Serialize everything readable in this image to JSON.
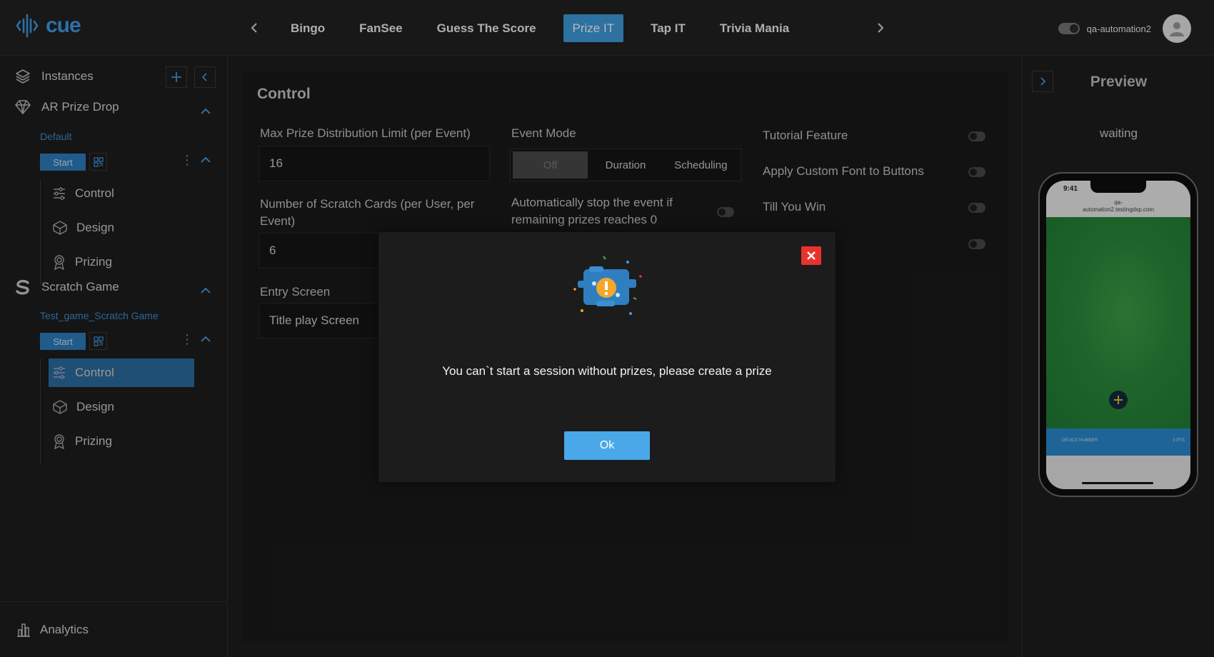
{
  "brand": {
    "name": "cue",
    "accent": "#3f9be8"
  },
  "nav": {
    "tabs": [
      {
        "label": "Bingo",
        "active": false
      },
      {
        "label": "FanSee",
        "active": false
      },
      {
        "label": "Guess The Score",
        "active": false
      },
      {
        "label": "Prize IT",
        "active": true
      },
      {
        "label": "Tap IT",
        "active": false
      },
      {
        "label": "Trivia Mania",
        "active": false
      }
    ],
    "prev_icon": "chevron-left-icon",
    "next_icon": "chevron-right-icon"
  },
  "user": {
    "name": "qa-automation2"
  },
  "sidebar": {
    "header": "Instances",
    "games": [
      {
        "title": "AR Prize Drop",
        "instance": "Default",
        "start_label": "Start",
        "items": [
          "Control",
          "Design",
          "Prizing"
        ]
      },
      {
        "title": "Scratch Game",
        "instance": "Test_game_Scratch Game",
        "start_label": "Start",
        "items": [
          "Control",
          "Design",
          "Prizing"
        ],
        "active_item": "Control"
      }
    ],
    "footer": "Analytics"
  },
  "main": {
    "title": "Control",
    "fields": {
      "max_prize": {
        "label": "Max Prize Distribution Limit (per Event)",
        "value": "16"
      },
      "scratch_cards": {
        "label_line1": "Number of Scratch Cards (per User, per",
        "label_line2": "Event)",
        "value": "6"
      },
      "entry_screen": {
        "label": "Entry Screen",
        "value": "Title play Screen"
      }
    },
    "event_mode": {
      "label": "Event Mode",
      "options": [
        "Off",
        "Duration",
        "Scheduling"
      ],
      "selected": "Off"
    },
    "auto_stop": {
      "line1": "Automatically stop the event if",
      "line2": "remaining prizes reaches 0"
    },
    "toggles": [
      {
        "label": "Tutorial Feature"
      },
      {
        "label": "Apply Custom Font to Buttons"
      },
      {
        "label": "Till You Win"
      }
    ]
  },
  "preview": {
    "title": "Preview",
    "status": "waiting",
    "phone": {
      "time": "9:41",
      "url_line1": "qa-",
      "url_line2": "automation2.testingdxp.com",
      "bar_left": "DEVICE NUMBER",
      "bar_right": "0 PTS"
    }
  },
  "modal": {
    "message": "You can`t start a session without prizes, please create a prize",
    "ok_label": "Ok"
  }
}
